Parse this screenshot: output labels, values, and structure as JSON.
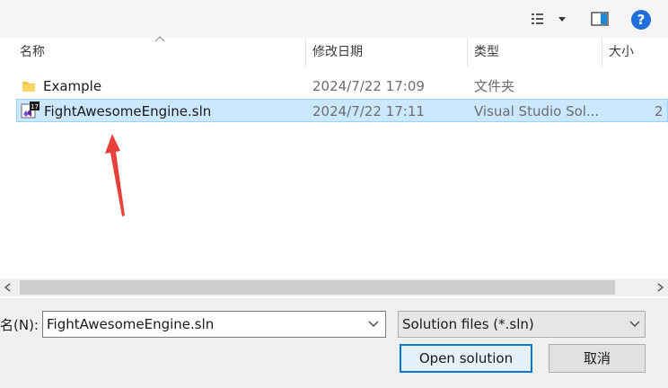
{
  "toolbar": {
    "view_icon": "view-options-icon",
    "preview_icon": "preview-pane-icon",
    "help_icon": "help-icon",
    "help_label": "?"
  },
  "columns": {
    "name": "名称",
    "date": "修改日期",
    "type": "类型",
    "size": "大小"
  },
  "rows": [
    {
      "name": "Example",
      "date": "2024/7/22 17:09",
      "type": "文件夹",
      "size": "",
      "icon": "folder-icon"
    },
    {
      "name": "FightAwesomeEngine.sln",
      "date": "2024/7/22 17:11",
      "type": "Visual Studio Sol...",
      "size": "2",
      "icon": "visual-studio-solution-icon",
      "badge": "17"
    }
  ],
  "filename": {
    "label": "名(N):",
    "value": "FightAwesomeEngine.sln"
  },
  "filetype": {
    "selected": "Solution files (*.sln)"
  },
  "buttons": {
    "open": "Open solution",
    "cancel": "取消"
  },
  "colors": {
    "selection_bg": "#cce8ff",
    "selection_border": "#99d1ff",
    "accent": "#0078d7",
    "annotation_arrow": "#e8403a"
  }
}
